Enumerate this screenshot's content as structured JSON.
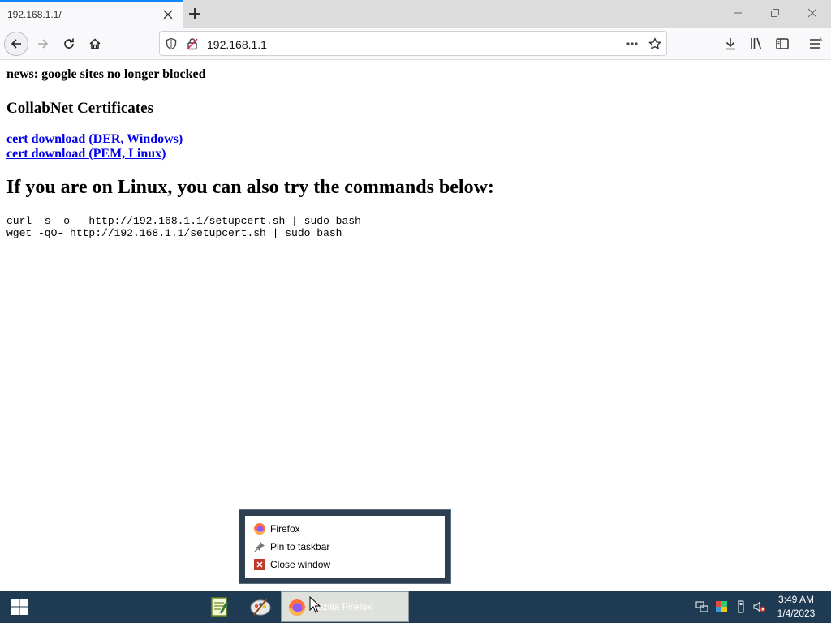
{
  "browser": {
    "tab_title": "192.168.1.1/",
    "url": "192.168.1.1"
  },
  "page": {
    "news": "news: google sites no longer blocked",
    "certs_heading": "CollabNet Certificates",
    "link_der": "cert download (DER, Windows)",
    "link_pem": "cert download (PEM, Linux)",
    "linux_heading": "If you are on Linux, you can also try the commands below:",
    "commands": [
      "curl -s -o - http://192.168.1.1/setupcert.sh | sudo bash",
      "wget -qO- http://192.168.1.1/setupcert.sh | sudo bash"
    ]
  },
  "jumplist": {
    "items": [
      {
        "label": "Firefox",
        "icon": "firefox-icon"
      },
      {
        "label": "Pin to taskbar",
        "icon": "pin-icon"
      },
      {
        "label": "Close window",
        "icon": "close-window-icon"
      }
    ]
  },
  "taskbar": {
    "firefox_label": "Mozilla Firefox",
    "time": "3:49 AM",
    "date": "1/4/2023"
  },
  "colors": {
    "taskbar": "#1f3b53",
    "tab_accent": "#0a84ff",
    "link": "#0000ee"
  }
}
